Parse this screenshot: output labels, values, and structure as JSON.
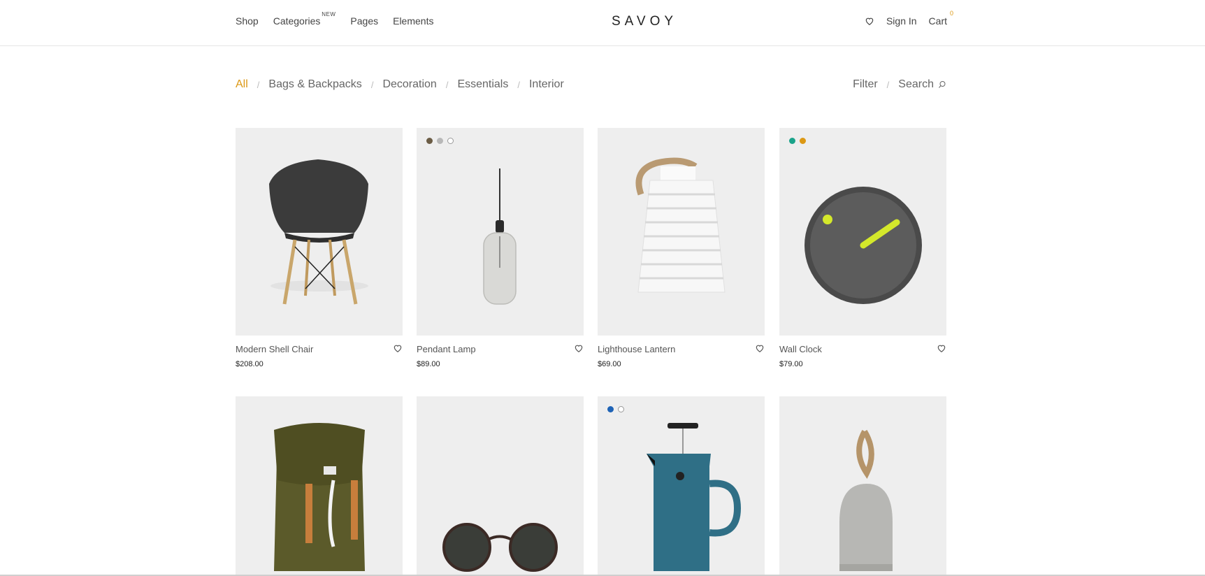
{
  "header": {
    "nav": [
      {
        "label": "Shop"
      },
      {
        "label": "Categories",
        "badge": "NEW"
      },
      {
        "label": "Pages"
      },
      {
        "label": "Elements"
      }
    ],
    "logo": "SAVOY",
    "signin": "Sign In",
    "cart_label": "Cart",
    "cart_count": "0",
    "wishlist_icon": "heart-icon"
  },
  "filters": {
    "categories": [
      "All",
      "Bags & Backpacks",
      "Decoration",
      "Essentials",
      "Interior"
    ],
    "active": "All",
    "separator": "/",
    "filter_label": "Filter",
    "search_label": "Search",
    "accent": "#dc9814"
  },
  "products": [
    {
      "name": "Modern Shell Chair",
      "price": "$208.00",
      "swatches": []
    },
    {
      "name": "Pendant Lamp",
      "price": "$89.00",
      "swatches": [
        "#6b5c45",
        "#b8b8b8",
        "#ffffff"
      ]
    },
    {
      "name": "Lighthouse Lantern",
      "price": "$69.00",
      "swatches": []
    },
    {
      "name": "Wall Clock",
      "price": "$79.00",
      "swatches": [
        "#1aa38a",
        "#dc9814"
      ]
    },
    {
      "name": "",
      "price": "",
      "swatches": []
    },
    {
      "name": "",
      "price": "",
      "swatches": []
    },
    {
      "name": "",
      "price": "",
      "swatches": [
        "#1e63b6",
        "#ffffff"
      ]
    },
    {
      "name": "",
      "price": "",
      "swatches": []
    }
  ]
}
